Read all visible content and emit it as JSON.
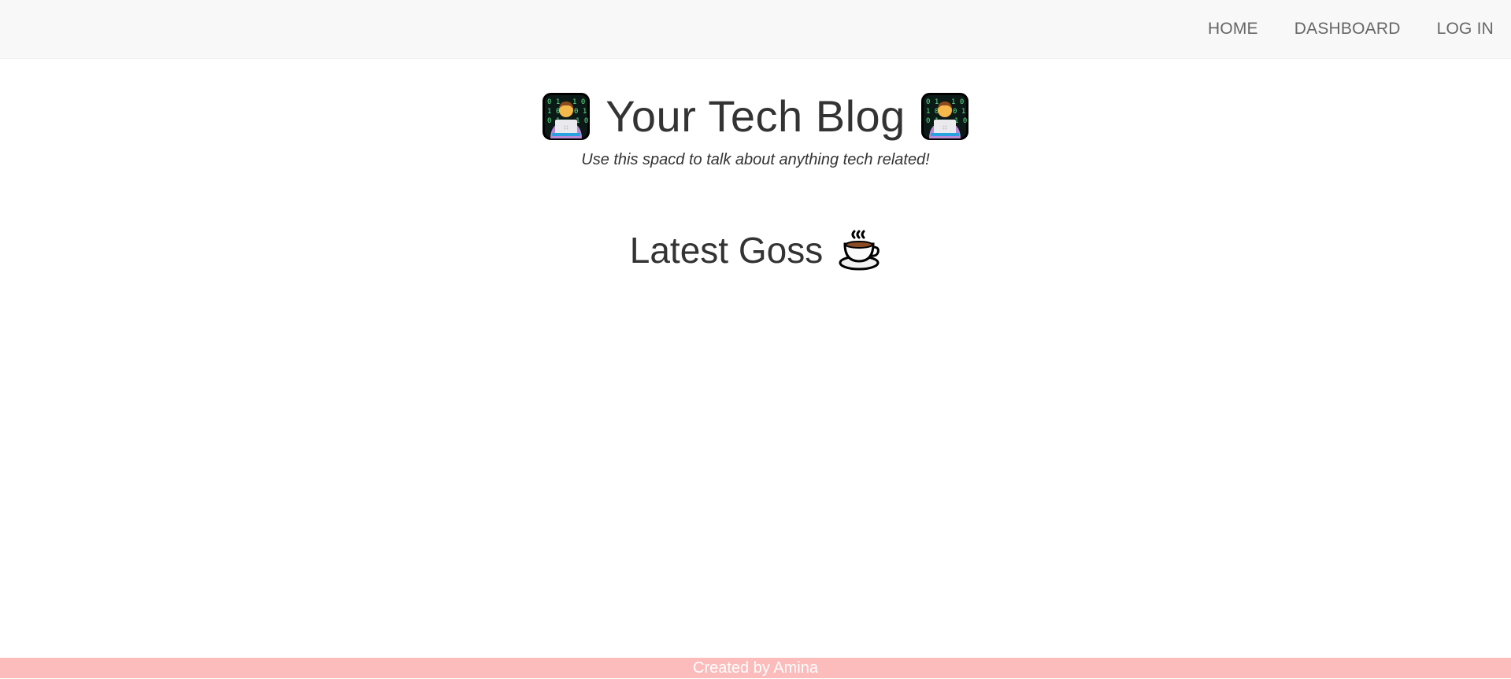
{
  "nav": {
    "links": [
      "HOME",
      "DASHBOARD",
      "LOG IN"
    ]
  },
  "hero": {
    "title": "Your Tech Blog",
    "subtitle": "Use this spacd to talk about anything tech related!",
    "icon": "technologist-emoji"
  },
  "section": {
    "title": "Latest Goss",
    "icon": "hot-beverage-emoji"
  },
  "footer": {
    "text": "Created by Amina"
  },
  "colors": {
    "navbar_bg": "#f8f8f8",
    "nav_link": "#666666",
    "text": "#333333",
    "footer_bg": "#fdbcbc",
    "footer_text": "#ffffff"
  }
}
